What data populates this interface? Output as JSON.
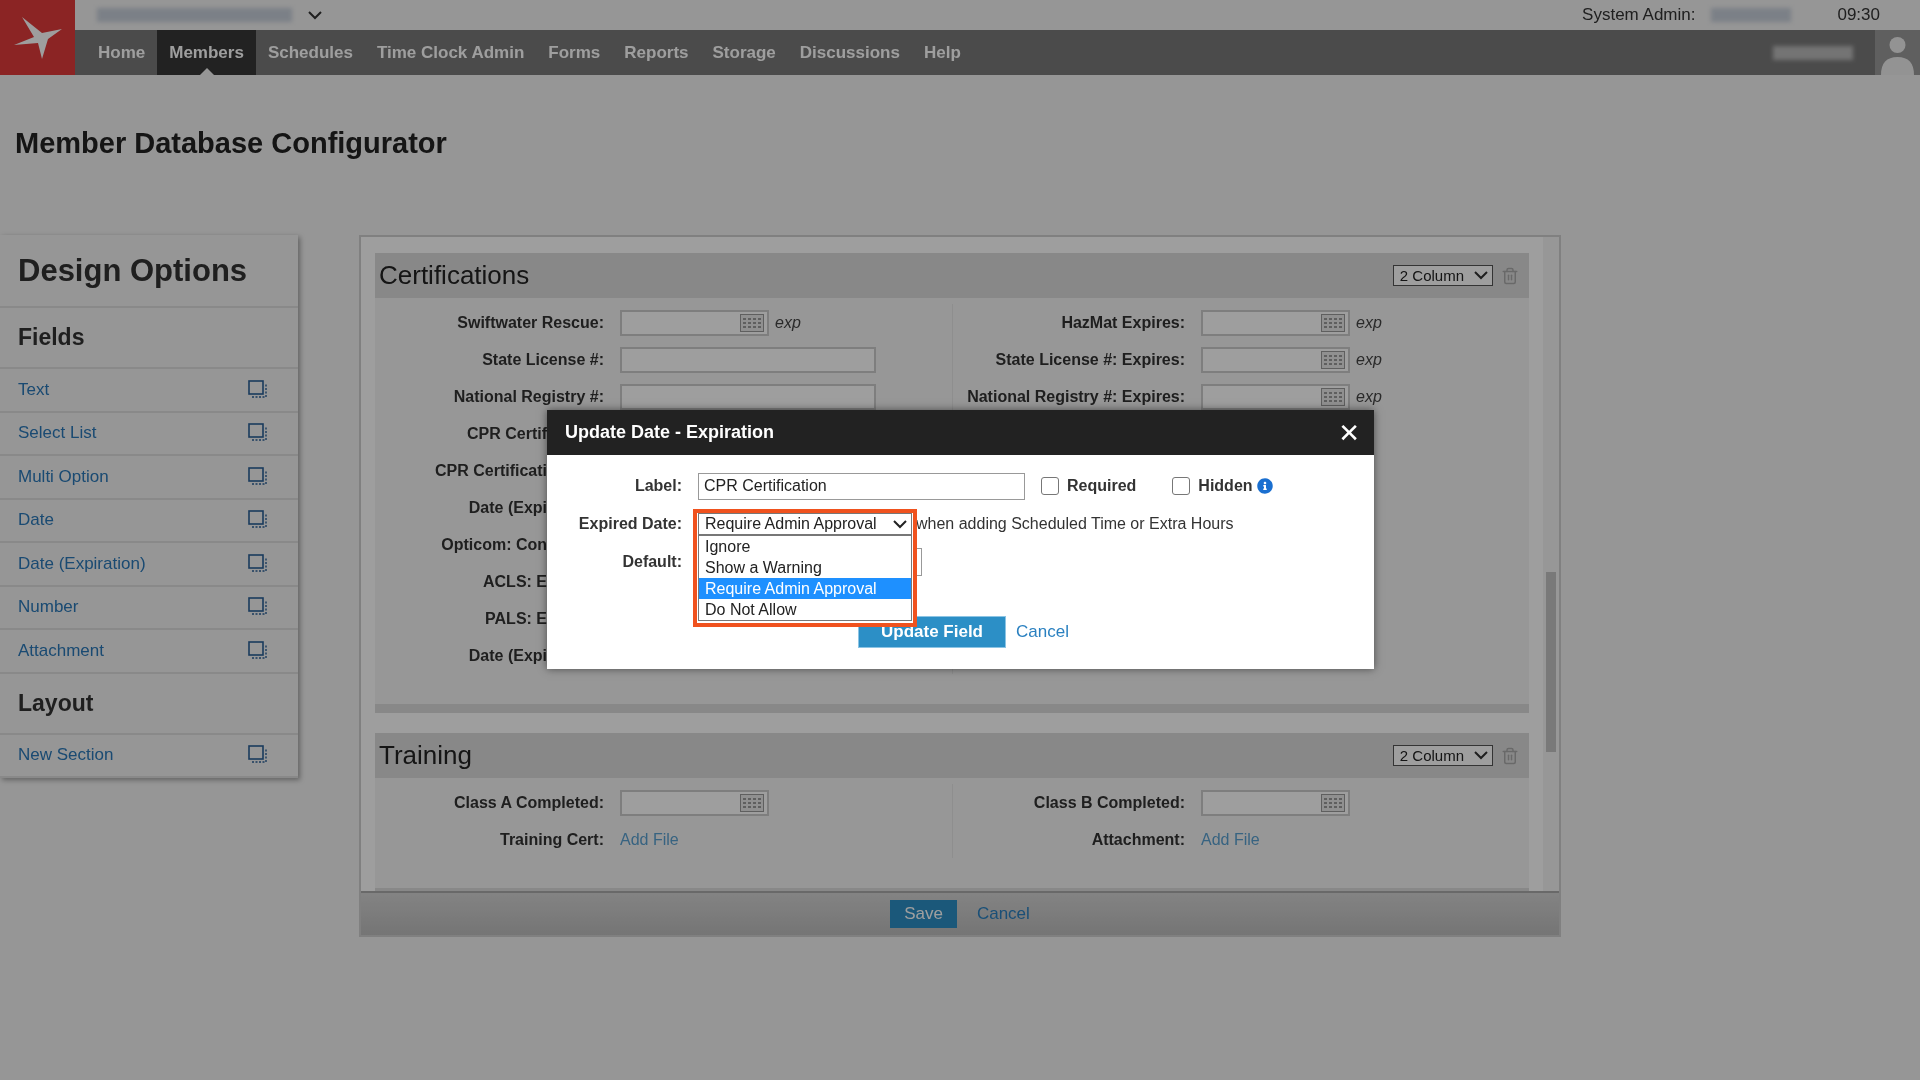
{
  "top_bar": {
    "admin_label": "System Admin:",
    "time": "09:30"
  },
  "nav": [
    {
      "label": "Home",
      "selected": false
    },
    {
      "label": "Members",
      "selected": true
    },
    {
      "label": "Schedules",
      "selected": false
    },
    {
      "label": "Time Clock Admin",
      "selected": false
    },
    {
      "label": "Forms",
      "selected": false
    },
    {
      "label": "Reports",
      "selected": false
    },
    {
      "label": "Storage",
      "selected": false
    },
    {
      "label": "Discussions",
      "selected": false
    },
    {
      "label": "Help",
      "selected": false
    }
  ],
  "page_title": "Member Database Configurator",
  "sidebar": {
    "title": "Design Options",
    "groups": [
      {
        "heading": "Fields",
        "items": [
          "Text",
          "Select List",
          "Multi Option",
          "Date",
          "Date (Expiration)",
          "Number",
          "Attachment"
        ]
      },
      {
        "heading": "Layout",
        "items": [
          "New Section"
        ]
      }
    ]
  },
  "sections": [
    {
      "title": "Certifications",
      "columns_select": "2 Column",
      "left_rows": [
        {
          "kind": "date",
          "label": "Swiftwater Rescue:",
          "suffix": "exp"
        },
        {
          "kind": "text",
          "label": "State License #:"
        },
        {
          "kind": "text",
          "label": "National Registry #:"
        },
        {
          "kind": "covered",
          "label": "CPR Certif"
        },
        {
          "kind": "covered",
          "label": "CPR Certificati"
        },
        {
          "kind": "covered",
          "label": "Date (Expi"
        },
        {
          "kind": "covered",
          "label": "Opticom: Con"
        },
        {
          "kind": "covered",
          "label": "ACLS: E"
        },
        {
          "kind": "covered",
          "label": "PALS: E"
        },
        {
          "kind": "covered",
          "label": "Date (Expi"
        }
      ],
      "right_rows": [
        {
          "kind": "date",
          "label": "HazMat Expires:",
          "suffix": "exp"
        },
        {
          "kind": "date",
          "label": "State License #: Expires:",
          "suffix": "exp"
        },
        {
          "kind": "date",
          "label": "National Registry #: Expires:",
          "suffix": "exp"
        }
      ]
    },
    {
      "title": "Training",
      "columns_select": "2 Column",
      "left_rows": [
        {
          "kind": "date",
          "label": "Class A Completed:"
        },
        {
          "kind": "file",
          "label": "Training Cert:",
          "link": "Add File"
        }
      ],
      "right_rows": [
        {
          "kind": "date",
          "label": "Class B Completed:"
        },
        {
          "kind": "file",
          "label": "Attachment:",
          "link": "Add File"
        }
      ]
    }
  ],
  "footer": {
    "save": "Save",
    "cancel": "Cancel"
  },
  "dialog": {
    "title": "Update Date - Expiration",
    "close": "✕",
    "label_caption": "Label:",
    "label_value": "CPR Certification",
    "required": {
      "label": "Required",
      "checked": false
    },
    "hidden": {
      "label": "Hidden",
      "checked": false
    },
    "expired_caption": "Expired Date:",
    "expired_value": "Require Admin Approval",
    "expired_note": "when adding Scheduled Time or Extra Hours",
    "options": [
      {
        "label": "Ignore",
        "selected": false
      },
      {
        "label": "Show a Warning",
        "selected": false
      },
      {
        "label": "Require Admin Approval",
        "selected": true
      },
      {
        "label": "Do Not Allow",
        "selected": false
      }
    ],
    "default_caption": "Default:",
    "update_button": "Update Field",
    "cancel_link": "Cancel"
  }
}
